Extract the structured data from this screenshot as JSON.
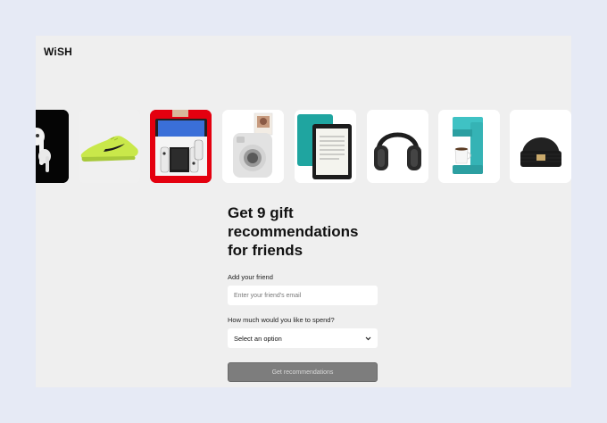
{
  "app": {
    "logo": "WiSH"
  },
  "carousel": {
    "items": [
      {
        "name": "airpods",
        "icon": "airpods-icon"
      },
      {
        "name": "running-shoe",
        "icon": "sneaker-icon"
      },
      {
        "name": "game-console",
        "icon": "nintendo-switch-icon"
      },
      {
        "name": "instant-camera",
        "icon": "instax-camera-icon"
      },
      {
        "name": "e-reader",
        "icon": "kindle-icon"
      },
      {
        "name": "headphones",
        "icon": "headphones-icon"
      },
      {
        "name": "coffee-maker",
        "icon": "coffee-maker-icon"
      },
      {
        "name": "beanie",
        "icon": "beanie-icon"
      }
    ]
  },
  "form": {
    "headline": "Get 9 gift recommendations for friends",
    "friend_label": "Add your friend",
    "friend_placeholder": "Enter your friend's email",
    "budget_label": "How much would you like to spend?",
    "budget_selected": "Select an option",
    "submit_label": "Get recommendations"
  },
  "colors": {
    "page_background": "#e6eaf5",
    "panel_background": "#efefef",
    "button_background": "#7d7d7d",
    "console_red": "#e4000f",
    "shoe_green": "#c9e84a",
    "kindle_teal": "#1fa5a0",
    "coffee_teal": "#3fc2c4"
  }
}
